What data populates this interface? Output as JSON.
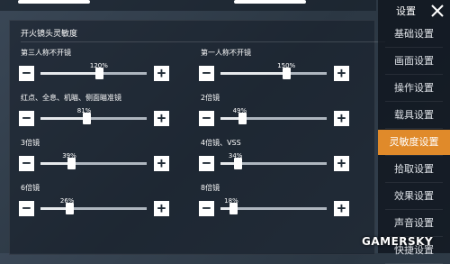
{
  "header": {
    "title": "设置"
  },
  "section": {
    "title": "开火镜头灵敏度"
  },
  "settings": [
    {
      "label": "第三人称不开镜",
      "value": 120,
      "value_text": "120%",
      "fraction": 0.55
    },
    {
      "label": "第一人称不开镜",
      "value": 150,
      "value_text": "150%",
      "fraction": 0.62
    },
    {
      "label": "红点、全息、机瞄、侧面瞄准镜",
      "value": 81,
      "value_text": "81%",
      "fraction": 0.43
    },
    {
      "label": "2倍镜",
      "value": 49,
      "value_text": "49%",
      "fraction": 0.2
    },
    {
      "label": "3倍镜",
      "value": 39,
      "value_text": "39%",
      "fraction": 0.29
    },
    {
      "label": "4倍镜、VSS",
      "value": 34,
      "value_text": "34%",
      "fraction": 0.16
    },
    {
      "label": "6倍镜",
      "value": 26,
      "value_text": "26%",
      "fraction": 0.27
    },
    {
      "label": "8倍镜",
      "value": 18,
      "value_text": "18%",
      "fraction": 0.12
    }
  ],
  "tabs": [
    {
      "label": "基础设置",
      "active": false
    },
    {
      "label": "画面设置",
      "active": false
    },
    {
      "label": "操作设置",
      "active": false
    },
    {
      "label": "载具设置",
      "active": false
    },
    {
      "label": "灵敏度设置",
      "active": true
    },
    {
      "label": "拾取设置",
      "active": false
    },
    {
      "label": "效果设置",
      "active": false
    },
    {
      "label": "声音设置",
      "active": false
    },
    {
      "label": "快捷设置",
      "active": false
    }
  ],
  "buttons": {
    "minus": "−",
    "plus": "+"
  },
  "icons": {
    "close": "close-icon"
  },
  "colors": {
    "active_tab": "#e08a2a",
    "panel": "#2b3743"
  },
  "watermark": "GAMERSKY"
}
